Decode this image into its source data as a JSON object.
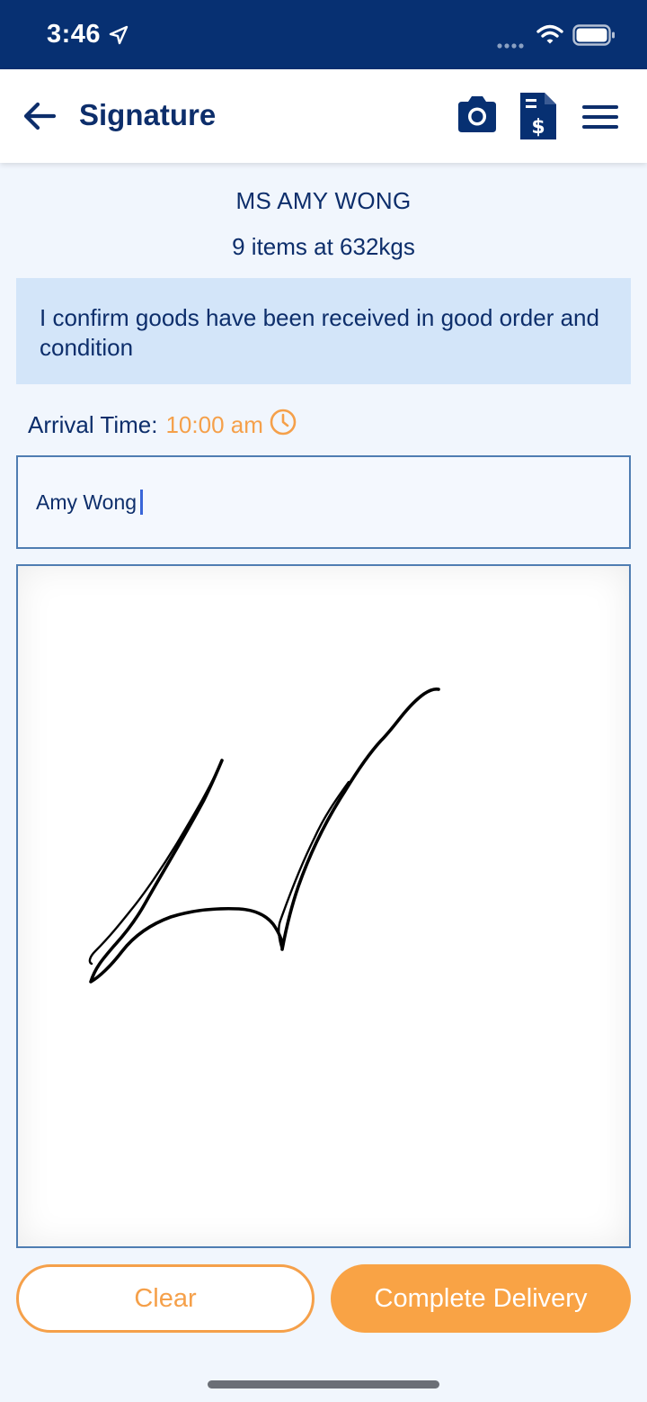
{
  "status_bar": {
    "time": "3:46",
    "icons": [
      "location-arrow-icon",
      "cellular-signal-icon",
      "wifi-icon",
      "battery-icon"
    ]
  },
  "header": {
    "title": "Signature",
    "icons": [
      "back-arrow-icon",
      "camera-icon",
      "invoice-document-icon",
      "hamburger-menu-icon"
    ]
  },
  "delivery": {
    "customer_name": "MS AMY WONG",
    "items_summary": "9 items at 632kgs",
    "confirmation_text": "I confirm goods have been received in good order and condition",
    "arrival_label": "Arrival Time:",
    "arrival_time": "10:00 am"
  },
  "name_input": {
    "value": "Amy Wong"
  },
  "actions": {
    "clear_label": "Clear",
    "complete_label": "Complete Delivery"
  },
  "colors": {
    "brand_navy": "#073072",
    "accent_orange": "#f9a345",
    "info_background": "#d3e5f9",
    "page_background": "#f1f6fd"
  }
}
